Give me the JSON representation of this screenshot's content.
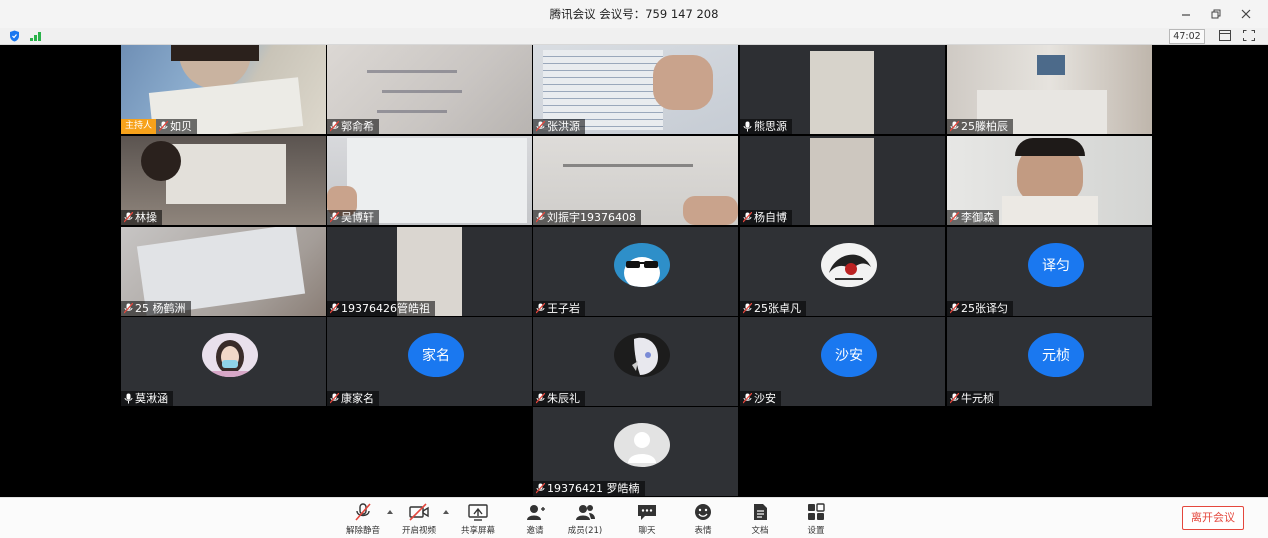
{
  "window": {
    "title": "腾讯会议 会议号：759 147 208",
    "timer": "47:02"
  },
  "participants": [
    {
      "name": "如贝",
      "host_badge": "主持人",
      "muted": true,
      "video": true
    },
    {
      "name": "郭俞希",
      "muted": true,
      "video": true
    },
    {
      "name": "张洪源",
      "muted": true,
      "video": true
    },
    {
      "name": "熊思源",
      "muted": false,
      "video": true
    },
    {
      "name": "25滕柏辰",
      "muted": true,
      "video": true
    },
    {
      "name": "林操",
      "muted": true,
      "video": true
    },
    {
      "name": "吴博轩",
      "muted": true,
      "video": true
    },
    {
      "name": "刘振宇19376408",
      "muted": true,
      "video": true
    },
    {
      "name": "杨自博",
      "muted": true,
      "video": true
    },
    {
      "name": "李御森",
      "muted": true,
      "video": true
    },
    {
      "name": "25 杨鹤洲",
      "muted": true,
      "video": true
    },
    {
      "name": "19376426管皓祖",
      "muted": true,
      "video": true
    },
    {
      "name": "王子岩",
      "muted": true,
      "video": false,
      "avatar": "sunglasses-avatar"
    },
    {
      "name": "25张卓凡",
      "muted": true,
      "video": false,
      "avatar": "anime-avatar"
    },
    {
      "name": "25张译匀",
      "muted": true,
      "video": false,
      "avatar_text": "译匀"
    },
    {
      "name": "莫湫涵",
      "muted": false,
      "video": false,
      "avatar": "girl-avatar"
    },
    {
      "name": "康家名",
      "muted": true,
      "video": false,
      "avatar_text": "家名"
    },
    {
      "name": "朱辰礼",
      "muted": true,
      "video": false,
      "avatar": "anime-avatar"
    },
    {
      "name": "沙安",
      "muted": true,
      "video": false,
      "avatar_text": "沙安"
    },
    {
      "name": "牛元桢",
      "muted": true,
      "video": false,
      "avatar_text": "元桢"
    },
    {
      "name": "19376421 罗皓楠",
      "muted": true,
      "video": false,
      "avatar": "default-avatar"
    }
  ],
  "toolbar": {
    "unmute": "解除静音",
    "start_video": "开启视频",
    "share_screen": "共享屏幕",
    "invite": "邀请",
    "members": "成员(21)",
    "chat": "聊天",
    "emoji": "表情",
    "docs": "文档",
    "settings": "设置",
    "leave": "离开会议"
  },
  "colors": {
    "accent": "#1a78f0",
    "host_badge": "#f7a21b",
    "leave": "#e4473d",
    "signal": "#2ab24a"
  }
}
